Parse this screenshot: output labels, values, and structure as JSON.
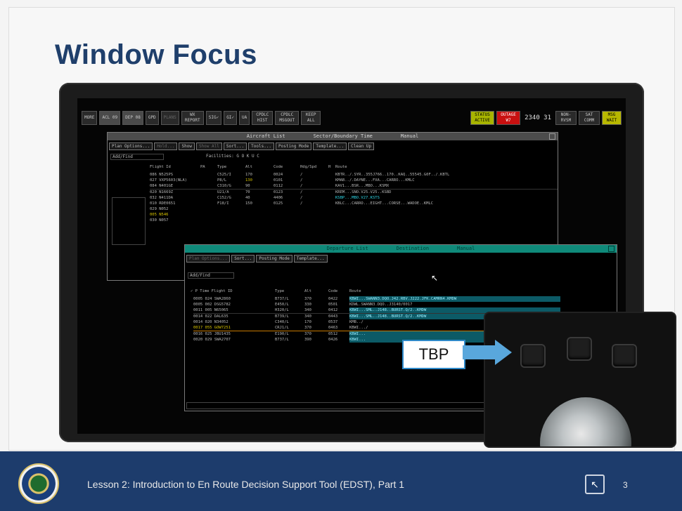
{
  "slide": {
    "title": "Window Focus",
    "footer_text": "Lesson 2: Introduction to En Route Decision Support Tool (EDST), Part 1",
    "page_number": "3",
    "callout_label": "TBP"
  },
  "topbar": {
    "buttons": [
      "MORE",
      "ACL 09",
      "DEP 08",
      "GPD",
      "PLANS",
      "WX REPORT",
      "SIG✓",
      "GI✓",
      "UA",
      "CPDLC HIST",
      "CPDLC MSGOUT",
      "KEEP ALL"
    ],
    "status": "STATUS ACTIVE",
    "outage": "OUTAGE W7",
    "time": "2340 31",
    "right_buttons": [
      "NON-RVSM",
      "SAT COMM",
      "MSG WAIT"
    ]
  },
  "acl": {
    "title": "Aircraft List",
    "sector": "Sector/Boundary Time",
    "mode": "Manual",
    "buttons": [
      "Plan Options...",
      "Hold...",
      "Show",
      "Show All",
      "Sort...",
      "Tools...",
      "Posting Mode",
      "Template...",
      "Clean Up"
    ],
    "add_find": "Add/Find",
    "facilities": "Facilities: G O K U C",
    "headers": [
      "Flight Id",
      "PA",
      "Type",
      "Alt",
      "Code",
      "Hdg/Spd",
      "H",
      "Route"
    ],
    "rows": [
      [
        "086 N525PS",
        "C525/I",
        "170",
        "0024",
        "/",
        "KBTR../.SYR..355J766..170..KAQ..55545.G0F../.KBTL"
      ],
      [
        "027 VXP5603(NLA)",
        "P8/L",
        "130",
        "0101",
        "/",
        "KMAB../.DAYNE...FXA...CARRO...KMLC"
      ],
      [
        "084 N401GE",
        "C310/G",
        "90",
        "0112",
        "/",
        "KAV1...BSR...MBO...KSMX"
      ],
      [
        "020 N1669Z",
        "U21/A",
        "70",
        "0123",
        "/",
        "KREM...SNO.V25.V25..KSBD"
      ],
      [
        "032 N411DA",
        "C152/G",
        "40",
        "4406",
        "/",
        "KSBP...MBO.V27.KSTS"
      ],
      [
        "010 RDE0651",
        "F18/I",
        "150",
        "0125",
        "/",
        "KBLC...CARRO...EIGHT...CORSE...WADOE..KMLC"
      ],
      [
        "029 N052",
        "",
        "",
        "",
        "",
        ""
      ],
      [
        "005 N546",
        "",
        "",
        "",
        "",
        ""
      ],
      [
        "030 N057",
        "",
        "",
        "",
        "",
        ""
      ]
    ]
  },
  "dep": {
    "title": "Departure List",
    "sector": "Destination",
    "mode": "Manual",
    "buttons": [
      "Plan Options...",
      "Sort...",
      "Posting Mode",
      "Template..."
    ],
    "add_find": "Add/Find",
    "headers": [
      "✓ P Time Flight ID",
      "Type",
      "Alt",
      "Code",
      "Route"
    ],
    "rows": [
      [
        "0005 024 SWA2860",
        "B737/L",
        "370",
        "0422",
        "KBWI...SWANN3.DQO.J42.RBV.J222.JFK.CAMRN4.KMDW"
      ],
      [
        "0005 002 DSG5782",
        "E450/L",
        "330",
        "0501",
        "KDWL.SWANN3.DQO..J3140/0017"
      ],
      [
        "0011 005 N65065",
        "H320/L",
        "340",
        "0412",
        "KBWI...SML..J148..BURST.Q/2..KMDW"
      ],
      [
        "0014 022 DAL635",
        "B739/L",
        "340",
        "0443",
        "KBWI...SML..J148..BURST.Q/2..KMDW"
      ],
      [
        "0014 020 N34052",
        "C340/L",
        "170",
        "0537",
        "KMB../"
      ],
      [
        "0017 055 GOW7251",
        "CRJ1/L",
        "370",
        "0463",
        "KBWI.../"
      ],
      [
        "0016 025 JBU1435",
        "E190/L",
        "370",
        "0512",
        "KBWI..."
      ],
      [
        "0020 029 SWA2707",
        "B737/L",
        "390",
        "0426",
        "KBWI..."
      ]
    ]
  }
}
